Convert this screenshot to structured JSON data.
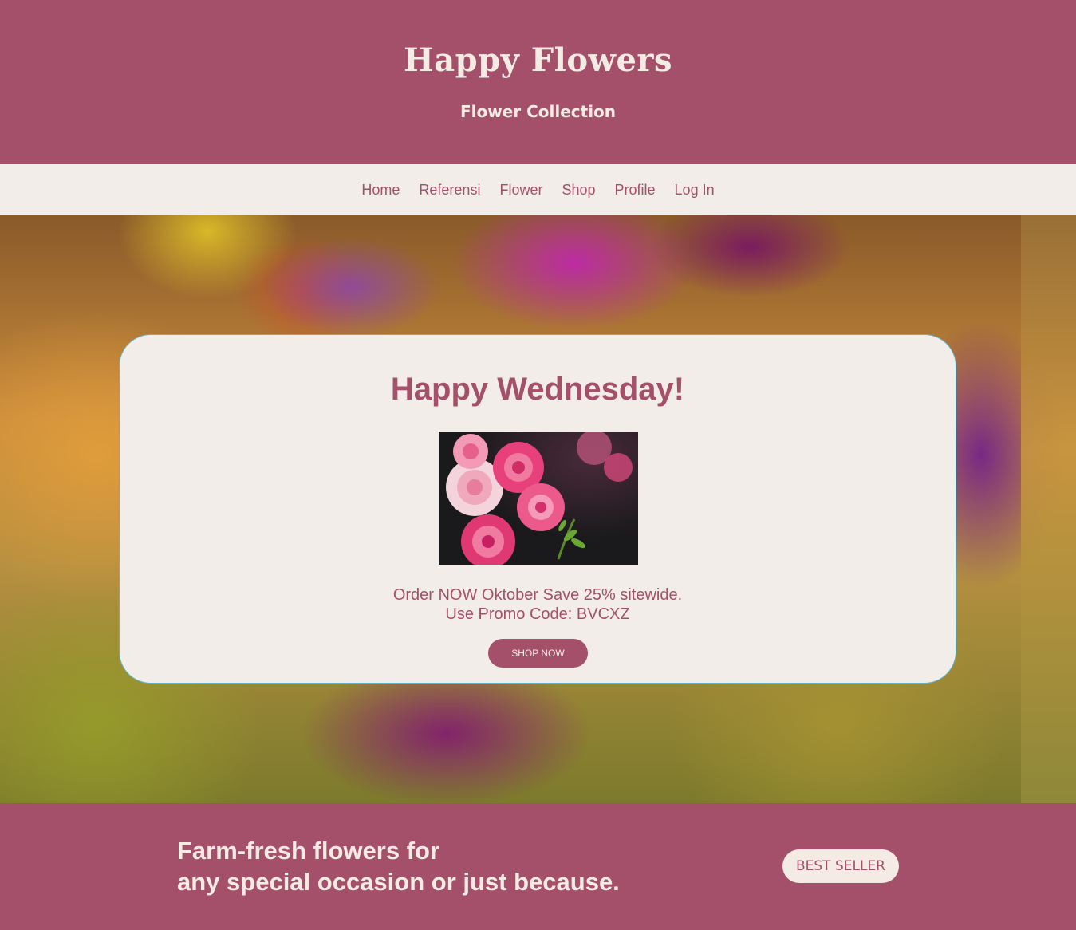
{
  "header": {
    "title": "Happy Flowers",
    "subtitle": "Flower Collection"
  },
  "nav": {
    "items": [
      "Home",
      "Referensi",
      "Flower",
      "Shop",
      "Profile",
      "Log In"
    ]
  },
  "promo": {
    "heading": "Happy Wednesday!",
    "line1": "Order NOW Oktober Save 25% sitewide.",
    "line2": "Use Promo Code: BVCXZ",
    "button": "SHOP NOW"
  },
  "footer": {
    "tagline_line1": "Farm-fresh flowers for",
    "tagline_line2": "any special occasion or just because.",
    "button": "BEST SELLER"
  },
  "colors": {
    "brand": "#a4506b",
    "light": "#f2ede9",
    "card_border": "#5eb3c4"
  }
}
